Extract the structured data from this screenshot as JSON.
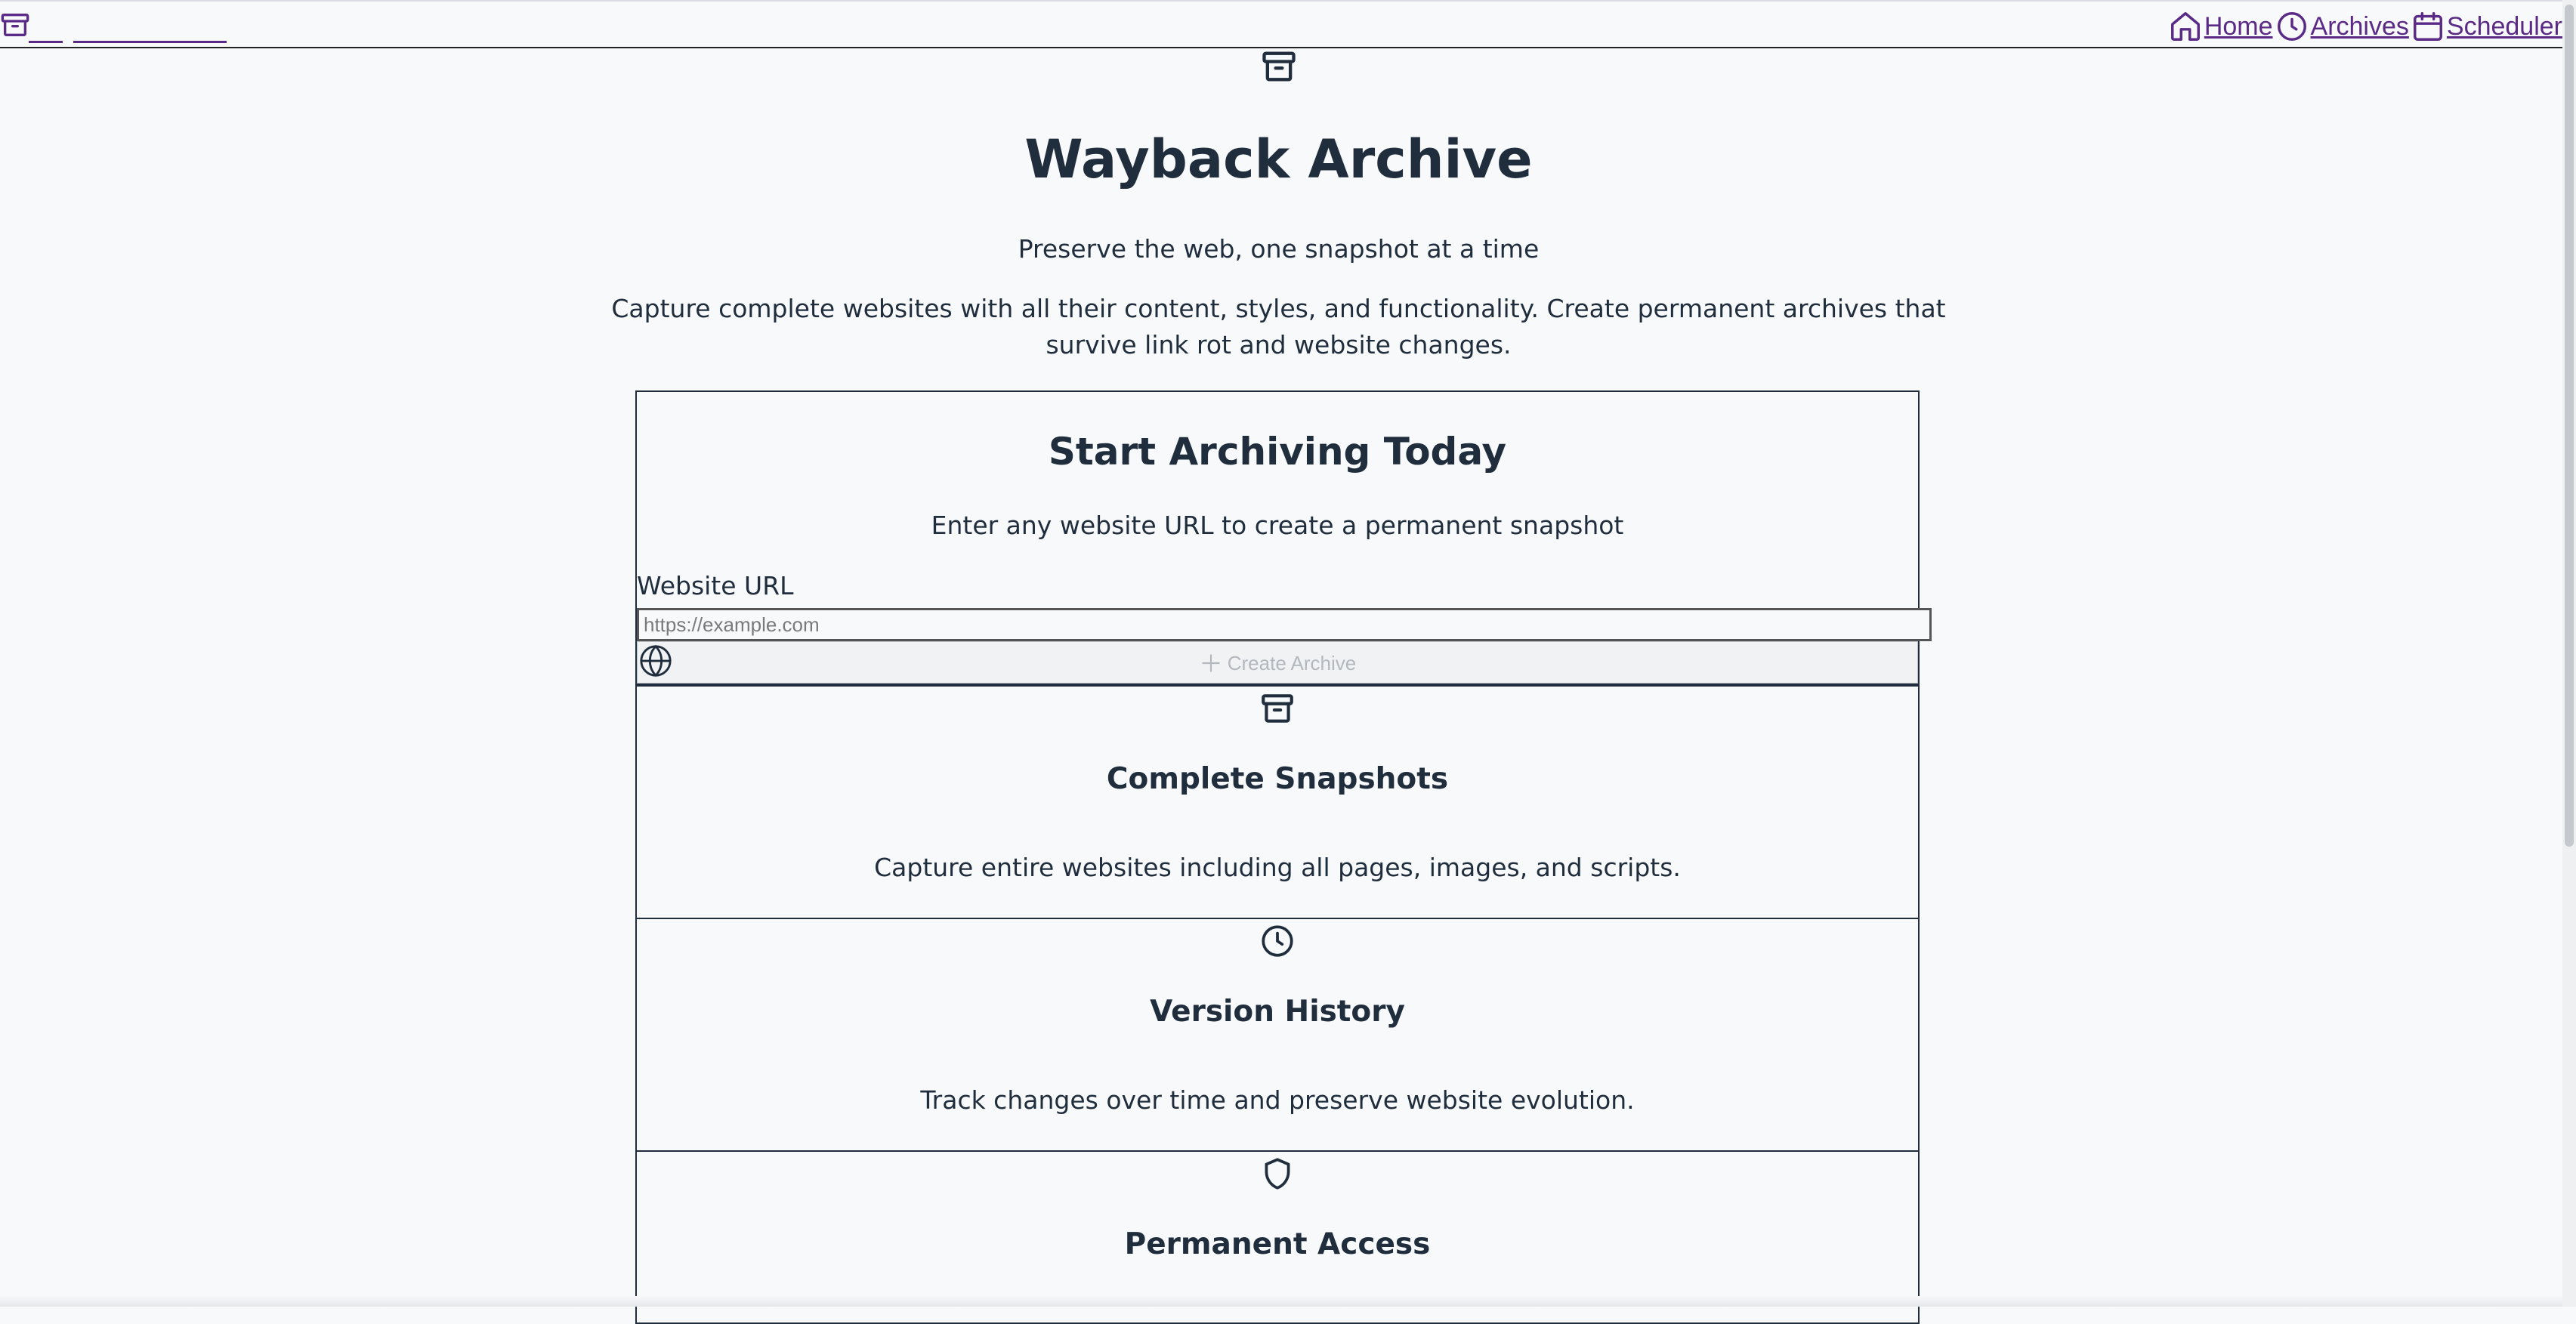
{
  "nav": {
    "links": [
      {
        "label": "Home",
        "icon": "home-icon"
      },
      {
        "label": "Archives",
        "icon": "clock-icon"
      },
      {
        "label": "Scheduler",
        "icon": "calendar-icon"
      }
    ],
    "link_color": "#5b2a86"
  },
  "hero": {
    "icon": "archive-box-icon",
    "title": "Wayback Archive",
    "tagline": "Preserve the web, one snapshot at a time",
    "description_line1": "Capture complete websites with all their content, styles, and functionality. Create permanent archives that",
    "description_line2": "survive link rot and website changes."
  },
  "cta": {
    "title": "Start Archiving Today",
    "subtitle": "Enter any website URL to create a permanent snapshot",
    "url_label": "Website URL",
    "url_placeholder": "https://example.com",
    "url_value": "",
    "button_label": "Create Archive"
  },
  "features": [
    {
      "icon": "archive-box-icon",
      "title": "Complete Snapshots",
      "text": "Capture entire websites including all pages, images, and scripts."
    },
    {
      "icon": "clock-icon",
      "title": "Version History",
      "text": "Track changes over time and preserve website evolution."
    },
    {
      "icon": "shield-icon",
      "title": "Permanent Access",
      "text": ""
    }
  ],
  "colors": {
    "text": "#1f2d3d",
    "background": "#f8f9fb"
  }
}
